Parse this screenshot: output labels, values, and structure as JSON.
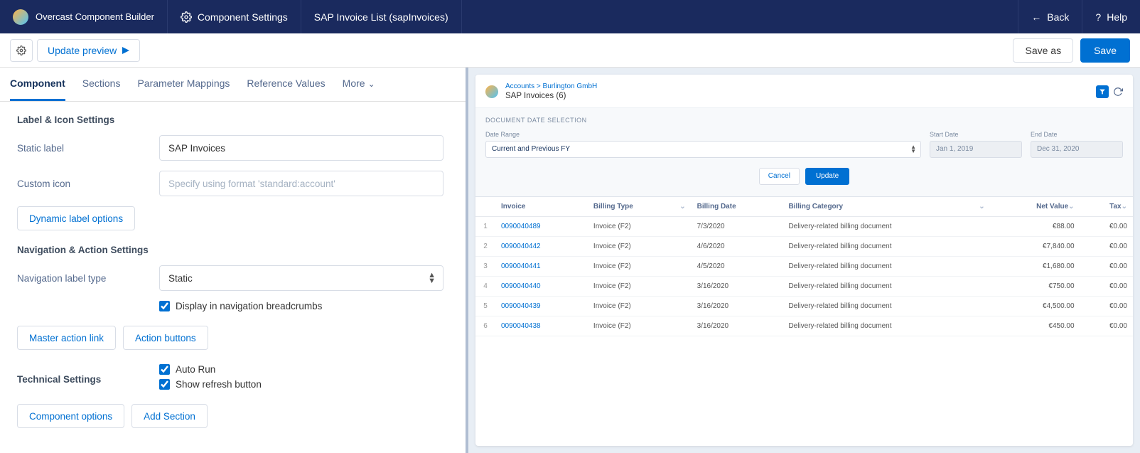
{
  "header": {
    "app_name": "Overcast Component Builder",
    "tab1_label": "Component Settings",
    "tab2_label": "SAP Invoice List (sapInvoices)",
    "back_label": "Back",
    "help_label": "Help"
  },
  "toolbar": {
    "update_preview": "Update preview",
    "save_as": "Save as",
    "save": "Save"
  },
  "tabs": [
    {
      "key": "component",
      "label": "Component",
      "active": true
    },
    {
      "key": "sections",
      "label": "Sections"
    },
    {
      "key": "parameter-mappings",
      "label": "Parameter Mappings"
    },
    {
      "key": "reference-values",
      "label": "Reference Values"
    },
    {
      "key": "more",
      "label": "More"
    }
  ],
  "form": {
    "section1_title": "Label & Icon Settings",
    "static_label_label": "Static label",
    "static_label_value": "SAP Invoices",
    "custom_icon_label": "Custom icon",
    "custom_icon_placeholder": "Specify using format 'standard:account'",
    "dynamic_label_btn": "Dynamic label options",
    "section2_title": "Navigation & Action Settings",
    "nav_label_type_label": "Navigation label type",
    "nav_label_type_value": "Static",
    "display_breadcrumbs_label": "Display in navigation breadcrumbs",
    "master_action_link_btn": "Master action link",
    "action_buttons_btn": "Action buttons",
    "section3_title": "Technical Settings",
    "auto_run_label": "Auto Run",
    "show_refresh_label": "Show refresh button",
    "component_options_btn": "Component options",
    "add_section_btn": "Add Section"
  },
  "preview": {
    "breadcrumb1": "Accounts",
    "breadcrumb2": "Burlington GmbH",
    "title": "SAP Invoices (6)",
    "doc_date_section": "DOCUMENT DATE SELECTION",
    "date_range_label": "Date Range",
    "date_range_value": "Current and Previous FY",
    "start_date_label": "Start Date",
    "start_date_value": "Jan 1, 2019",
    "end_date_label": "End Date",
    "end_date_value": "Dec 31, 2020",
    "cancel_btn": "Cancel",
    "update_btn": "Update",
    "columns": {
      "invoice": "Invoice",
      "billing_type": "Billing Type",
      "billing_date": "Billing Date",
      "billing_category": "Billing Category",
      "net_value": "Net Value",
      "tax": "Tax"
    },
    "rows": [
      {
        "n": "1",
        "invoice": "0090040489",
        "type": "Invoice (F2)",
        "date": "7/3/2020",
        "category": "Delivery-related billing document",
        "net": "€88.00",
        "tax": "€0.00"
      },
      {
        "n": "2",
        "invoice": "0090040442",
        "type": "Invoice (F2)",
        "date": "4/6/2020",
        "category": "Delivery-related billing document",
        "net": "€7,840.00",
        "tax": "€0.00"
      },
      {
        "n": "3",
        "invoice": "0090040441",
        "type": "Invoice (F2)",
        "date": "4/5/2020",
        "category": "Delivery-related billing document",
        "net": "€1,680.00",
        "tax": "€0.00"
      },
      {
        "n": "4",
        "invoice": "0090040440",
        "type": "Invoice (F2)",
        "date": "3/16/2020",
        "category": "Delivery-related billing document",
        "net": "€750.00",
        "tax": "€0.00"
      },
      {
        "n": "5",
        "invoice": "0090040439",
        "type": "Invoice (F2)",
        "date": "3/16/2020",
        "category": "Delivery-related billing document",
        "net": "€4,500.00",
        "tax": "€0.00"
      },
      {
        "n": "6",
        "invoice": "0090040438",
        "type": "Invoice (F2)",
        "date": "3/16/2020",
        "category": "Delivery-related billing document",
        "net": "€450.00",
        "tax": "€0.00"
      }
    ]
  }
}
